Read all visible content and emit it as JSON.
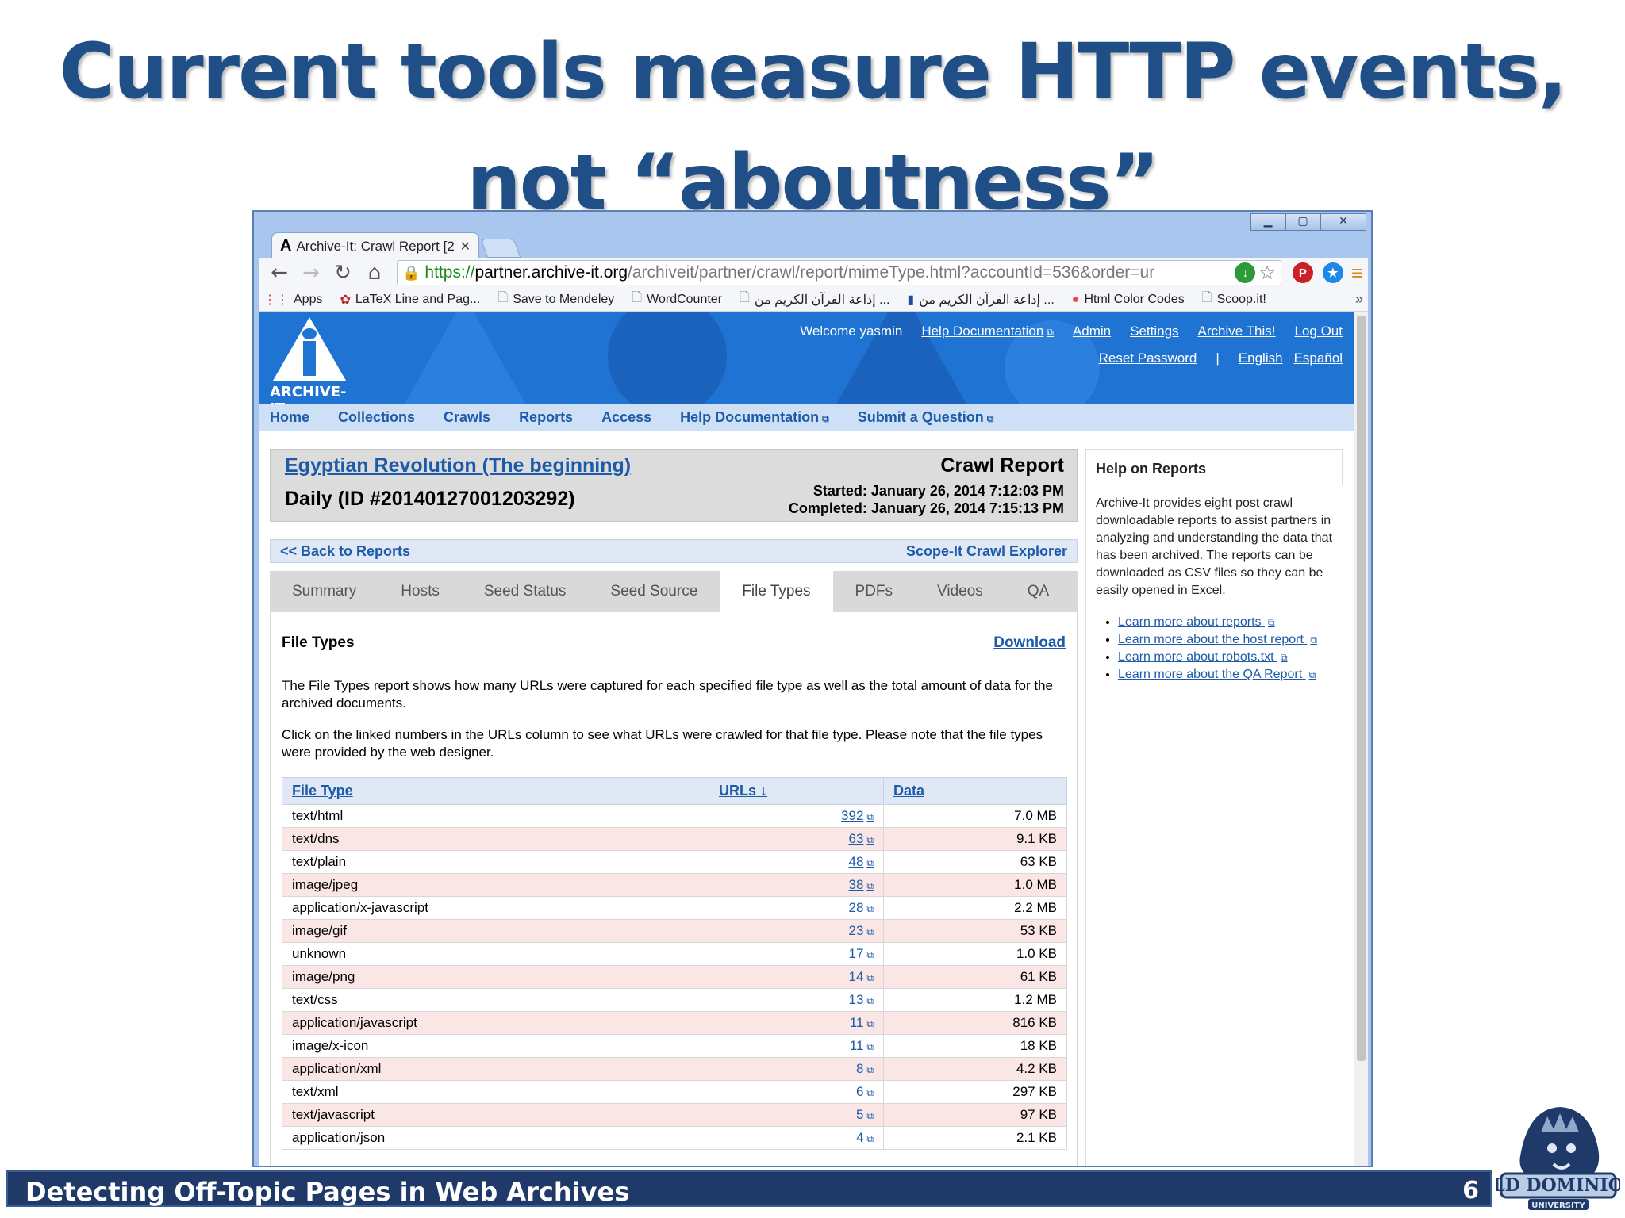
{
  "slide": {
    "title_line1": "Current tools measure HTTP events,",
    "title_line2": "not “aboutness”",
    "footer_title": "Detecting Off-Topic Pages in Web Archives",
    "page_number": "6",
    "logo_text": "OLD DOMINION",
    "logo_subtext": "UNIVERSITY"
  },
  "browser": {
    "tab_title": "Archive-It: Crawl Report [2",
    "url_scheme": "https://",
    "url_host": "partner.archive-it.org",
    "url_path": "/archiveit/partner/crawl/report/mimeType.html?accountId=536&order=ur",
    "bookmarks": [
      "Apps",
      "LaTeX Line and Pag...",
      "Save to Mendeley",
      "WordCounter",
      "إذاعة القرآن الكريم من ...",
      "إذاعة القرآن الكريم من ...",
      "Html Color Codes",
      "Scoop.it!"
    ],
    "bookmarks_more": "»"
  },
  "site": {
    "logo_text": "ARCHIVE-IT",
    "welcome": "Welcome yasmin",
    "header_links": [
      "Help Documentation",
      "Admin",
      "Settings",
      "Archive This!",
      "Log Out"
    ],
    "reset_password": "Reset Password",
    "separator": "|",
    "lang_english": "English",
    "lang_spanish": "Español",
    "nav": [
      "Home",
      "Collections",
      "Crawls",
      "Reports",
      "Access",
      "Help Documentation",
      "Submit a Question"
    ]
  },
  "crawl": {
    "collection": "Egyptian Revolution (The beginning)",
    "daily": "Daily (ID #20140127001203292)",
    "report_label": "Crawl Report",
    "started": "Started: January 26, 2014 7:12:03 PM",
    "completed": "Completed: January 26, 2014 7:15:13 PM",
    "back": "<< Back to Reports",
    "scope": "Scope-It Crawl Explorer"
  },
  "tabs": [
    "Summary",
    "Hosts",
    "Seed Status",
    "Seed Source",
    "File Types",
    "PDFs",
    "Videos",
    "QA"
  ],
  "active_tab": "File Types",
  "filetypes": {
    "heading": "File Types",
    "download": "Download",
    "para1": "The File Types report shows how many URLs were captured for each specified file type as well as the total amount of data for the archived documents.",
    "para2": "Click on the linked numbers in the URLs column to see what URLs were crawled for that file type. Please note that the file types were provided by the web designer.",
    "columns": [
      "File Type",
      "URLs ↓",
      "Data"
    ],
    "rows": [
      [
        "text/html",
        "392",
        "7.0 MB"
      ],
      [
        "text/dns",
        "63",
        "9.1 KB"
      ],
      [
        "text/plain",
        "48",
        "63 KB"
      ],
      [
        "image/jpeg",
        "38",
        "1.0 MB"
      ],
      [
        "application/x-javascript",
        "28",
        "2.2 MB"
      ],
      [
        "image/gif",
        "23",
        "53 KB"
      ],
      [
        "unknown",
        "17",
        "1.0 KB"
      ],
      [
        "image/png",
        "14",
        "61 KB"
      ],
      [
        "text/css",
        "13",
        "1.2 MB"
      ],
      [
        "application/javascript",
        "11",
        "816 KB"
      ],
      [
        "image/x-icon",
        "11",
        "18 KB"
      ],
      [
        "application/xml",
        "8",
        "4.2 KB"
      ],
      [
        "text/xml",
        "6",
        "297 KB"
      ],
      [
        "text/javascript",
        "5",
        "97 KB"
      ],
      [
        "application/json",
        "4",
        "2.1 KB"
      ]
    ]
  },
  "help": {
    "heading": "Help on Reports",
    "text": "Archive-It provides eight post crawl downloadable reports to assist partners in analyzing and understanding the data that has been archived. The reports can be downloaded as CSV files so they can be easily opened in Excel.",
    "links": [
      "Learn more about reports",
      "Learn more about the host report",
      "Learn more about robots.txt",
      "Learn more about the QA Report"
    ]
  },
  "colors": {
    "title": "#1f4f86",
    "header_blue": "#1f73d2",
    "link": "#1d5aa8",
    "alt_row": "#fbe6e6",
    "footer": "#1f3a68"
  }
}
